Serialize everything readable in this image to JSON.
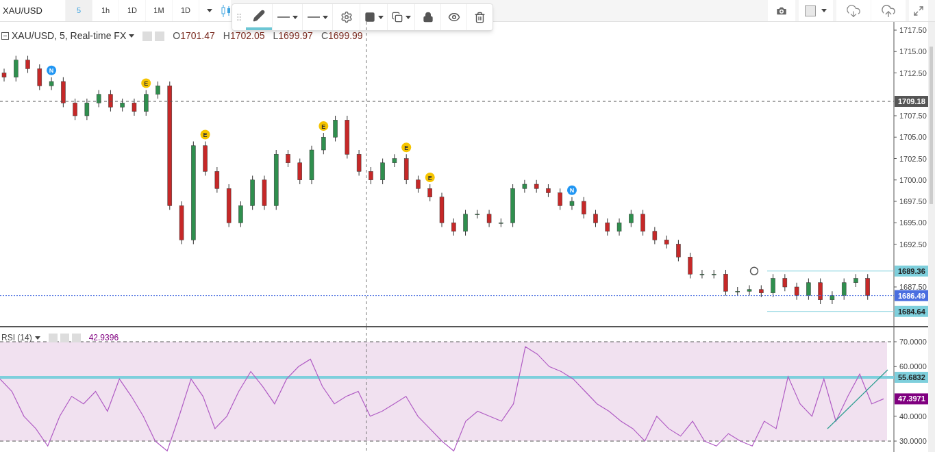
{
  "toolbar": {
    "symbol": "XAU/USD",
    "intervals": [
      {
        "label": "5",
        "selected": true
      },
      {
        "label": "1h",
        "selected": false
      },
      {
        "label": "1D",
        "selected": false
      },
      {
        "label": "1M",
        "selected": false
      },
      {
        "label": "1D",
        "selected": false
      }
    ]
  },
  "drawing_toolbar": {
    "pencil_active": true
  },
  "legend": {
    "ohlc": [
      {
        "key": "O",
        "value": "1701.47"
      },
      {
        "key": "H",
        "value": "1702.05"
      },
      {
        "key": "L",
        "value": "1699.97"
      },
      {
        "key": "C",
        "value": "1699.99"
      }
    ]
  },
  "price_chart": {
    "events": [
      {
        "kind": "news",
        "label": "N",
        "color": "#2196f3"
      },
      {
        "kind": "earnings",
        "label": "E",
        "color": "#f5c400"
      },
      {
        "kind": "earnings",
        "label": "E",
        "color": "#f5c400"
      },
      {
        "kind": "earnings",
        "label": "E",
        "color": "#f5c400"
      },
      {
        "kind": "earnings",
        "label": "E",
        "color": "#f5c400"
      },
      {
        "kind": "earnings",
        "label": "E",
        "color": "#f5c400"
      },
      {
        "kind": "news",
        "label": "N",
        "color": "#2196f3"
      }
    ],
    "chart_data": {
      "type": "candlestick",
      "title": "XAU/USD, 5, Real-time FX",
      "ohlc": [
        [
          1712.5,
          1713,
          1711.5,
          1712
        ],
        [
          1712,
          1714.5,
          1711.5,
          1714
        ],
        [
          1714,
          1714.5,
          1712.5,
          1713
        ],
        [
          1713,
          1713.5,
          1710.5,
          1711
        ],
        [
          1711,
          1712,
          1710.5,
          1711.5
        ],
        [
          1711.5,
          1712,
          1708.5,
          1709
        ],
        [
          1709,
          1709.5,
          1707,
          1707.5
        ],
        [
          1707.5,
          1709.5,
          1707,
          1709
        ],
        [
          1709,
          1710.5,
          1708.5,
          1710
        ],
        [
          1710,
          1710.5,
          1708,
          1708.5
        ],
        [
          1708.5,
          1709.5,
          1708,
          1709
        ],
        [
          1709,
          1709.5,
          1707.5,
          1708
        ],
        [
          1708,
          1710.5,
          1707.5,
          1710
        ],
        [
          1710,
          1711.5,
          1709.5,
          1711
        ],
        [
          1711,
          1711.5,
          1696.5,
          1697
        ],
        [
          1697,
          1697.5,
          1692.5,
          1693
        ],
        [
          1693,
          1704.5,
          1692.5,
          1704
        ],
        [
          1704,
          1704.5,
          1700.5,
          1701
        ],
        [
          1701,
          1701.5,
          1698.5,
          1699
        ],
        [
          1699,
          1699.5,
          1694.5,
          1695
        ],
        [
          1695,
          1697.5,
          1694.5,
          1697
        ],
        [
          1697,
          1700.5,
          1696.5,
          1700
        ],
        [
          1700,
          1700.5,
          1696.5,
          1697
        ],
        [
          1697,
          1703.5,
          1696.5,
          1703
        ],
        [
          1703,
          1703.5,
          1701.5,
          1702
        ],
        [
          1702,
          1702.5,
          1699.5,
          1700
        ],
        [
          1700,
          1704,
          1699.5,
          1703.5
        ],
        [
          1703.5,
          1705.5,
          1703,
          1705
        ],
        [
          1705,
          1707.5,
          1704.5,
          1707
        ],
        [
          1707,
          1707.5,
          1702.5,
          1703
        ],
        [
          1703,
          1703.5,
          1700.5,
          1701
        ],
        [
          1701,
          1701.5,
          1699.5,
          1700
        ],
        [
          1700,
          1702.5,
          1699.5,
          1702
        ],
        [
          1702,
          1703,
          1701.5,
          1702.5
        ],
        [
          1702.5,
          1703,
          1699.5,
          1700
        ],
        [
          1700,
          1700.5,
          1698.5,
          1699
        ],
        [
          1699,
          1699.5,
          1697.5,
          1698
        ],
        [
          1698,
          1698.5,
          1694.5,
          1695
        ],
        [
          1695,
          1695.5,
          1693.5,
          1694
        ],
        [
          1694,
          1696.5,
          1693.5,
          1696
        ],
        [
          1696,
          1696.5,
          1695.5,
          1696
        ],
        [
          1696,
          1696.5,
          1694.5,
          1695
        ],
        [
          1695,
          1695.5,
          1694.5,
          1695
        ],
        [
          1695,
          1699.5,
          1694.5,
          1699
        ],
        [
          1699,
          1700,
          1698.5,
          1699.5
        ],
        [
          1699.5,
          1700,
          1698.5,
          1699
        ],
        [
          1699,
          1699.5,
          1698,
          1698.5
        ],
        [
          1698.5,
          1699,
          1696.5,
          1697
        ],
        [
          1697,
          1698,
          1696.5,
          1697.5
        ],
        [
          1697.5,
          1698,
          1695.5,
          1696
        ],
        [
          1696,
          1696.5,
          1694.5,
          1695
        ],
        [
          1695,
          1695.5,
          1693.5,
          1694
        ],
        [
          1694,
          1695.5,
          1693.5,
          1695
        ],
        [
          1695,
          1696.5,
          1694.5,
          1696
        ],
        [
          1696,
          1696.5,
          1693.5,
          1694
        ],
        [
          1694,
          1694.5,
          1692.5,
          1693
        ],
        [
          1693,
          1693.5,
          1692,
          1692.5
        ],
        [
          1692.5,
          1693,
          1690.5,
          1691
        ],
        [
          1691,
          1691.5,
          1688.5,
          1689
        ],
        [
          1689,
          1689.5,
          1688.5,
          1689
        ],
        [
          1689,
          1689.5,
          1688.5,
          1689
        ],
        [
          1689,
          1689.5,
          1686.5,
          1687
        ],
        [
          1687,
          1687.5,
          1686.5,
          1687
        ],
        [
          1687,
          1687.7,
          1686.5,
          1687.2
        ],
        [
          1687.2,
          1687.7,
          1686.3,
          1686.8
        ],
        [
          1686.8,
          1689,
          1686.3,
          1688.5
        ],
        [
          1688.5,
          1689,
          1687,
          1687.5
        ],
        [
          1687.5,
          1688,
          1686,
          1686.5
        ],
        [
          1686.5,
          1688.5,
          1686,
          1688
        ],
        [
          1688,
          1688.5,
          1685.5,
          1686
        ],
        [
          1686,
          1687,
          1685.5,
          1686.5
        ],
        [
          1686.5,
          1688.5,
          1686,
          1688
        ],
        [
          1688,
          1689,
          1687.5,
          1688.5
        ],
        [
          1688.5,
          1689,
          1686,
          1686.5
        ]
      ],
      "ylim": [
        1682.94,
        1718.46
      ],
      "yticks": [
        {
          "value": 1717.5,
          "label": "1717.50"
        },
        {
          "value": 1715,
          "label": "1715.00"
        },
        {
          "value": 1712.5,
          "label": "1712.50"
        },
        {
          "value": 1707.5,
          "label": "1707.50"
        },
        {
          "value": 1705,
          "label": "1705.00"
        },
        {
          "value": 1702.5,
          "label": "1702.50"
        },
        {
          "value": 1700,
          "label": "1700.00"
        },
        {
          "value": 1697.5,
          "label": "1697.50"
        },
        {
          "value": 1695,
          "label": "1695.00"
        },
        {
          "value": 1692.5,
          "label": "1692.50"
        },
        {
          "value": 1687.5,
          "label": "1687.50"
        }
      ],
      "ref_lines": [
        {
          "axis": "y",
          "value": 1709.18,
          "label": "1709.18",
          "color": "#555555"
        },
        {
          "axis": "y",
          "value": 1689.36,
          "label": "1689.36",
          "color": "#7ecfdc"
        },
        {
          "axis": "y",
          "value": 1686.49,
          "label": "1686.49",
          "color": "#4a6ee0"
        },
        {
          "axis": "y",
          "value": 1684.64,
          "label": "1684.64",
          "color": "#7ecfdc"
        }
      ]
    }
  },
  "rsi": {
    "value": "42.9396",
    "chart_data": {
      "type": "line",
      "series": [
        {
          "name": "RSI (14)",
          "color": "#b05cc4",
          "values": [
            55,
            50,
            40,
            35,
            28,
            40,
            48,
            45,
            50,
            42,
            55,
            48,
            40,
            30,
            26,
            40,
            55,
            48,
            35,
            40,
            50,
            58,
            52,
            45,
            55,
            60,
            63,
            52,
            45,
            48,
            50,
            40,
            42,
            45,
            48,
            40,
            35,
            30,
            26,
            38,
            42,
            40,
            38,
            45,
            68,
            65,
            60,
            58,
            55,
            50,
            45,
            42,
            38,
            35,
            30,
            40,
            35,
            32,
            38,
            30,
            28,
            33,
            30,
            28,
            38,
            35,
            56,
            45,
            40,
            55,
            38,
            48,
            57,
            45,
            47
          ]
        }
      ],
      "ylim": [
        25.6,
        75.8
      ],
      "yticks": [
        {
          "value": 70,
          "label": "70.0000"
        },
        {
          "value": 60,
          "label": "60.0000"
        },
        {
          "value": 40,
          "label": "40.0000"
        },
        {
          "value": 30,
          "label": "30.0000"
        }
      ],
      "ref_lines": [
        {
          "axis": "y",
          "value": 55.6832,
          "label": "55.6832",
          "color": "#7ecfdc"
        }
      ]
    },
    "current_badge": {
      "label": "47.3971",
      "color": "#800080"
    }
  }
}
